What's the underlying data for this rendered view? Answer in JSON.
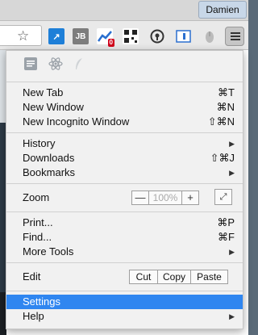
{
  "titlebar": {
    "user": "Damien"
  },
  "toolbar": {
    "star_icon": "star-icon",
    "extensions": [
      {
        "name": "arrow-icon",
        "glyph": "↗",
        "bg": "#1e7fd8",
        "color": "#ffffff"
      },
      {
        "name": "jb-icon",
        "glyph": "JB",
        "bg": "#7d7d7d",
        "color": "#ffffff"
      },
      {
        "name": "chart-icon",
        "glyph": "📈",
        "bg": "#2a6fcf",
        "color": "#ffffff",
        "badge": "0"
      },
      {
        "name": "qr-icon",
        "glyph": "▦",
        "bg": "#ffffff",
        "color": "#222222"
      },
      {
        "name": "pin-icon",
        "glyph": "◉",
        "bg": "#e9e9e9",
        "color": "#333333"
      },
      {
        "name": "page-icon",
        "glyph": "◧",
        "bg": "#e9e9e9",
        "color": "#2a6fcf"
      },
      {
        "name": "mouse-icon",
        "glyph": "●",
        "bg": "#e9e9e9",
        "color": "#9a9a9a"
      }
    ],
    "menu_icon": "hamburger-menu-icon"
  },
  "menu": {
    "icons": [
      "notes-icon",
      "react-atom-icon",
      "feather-icon"
    ],
    "new_tab": "New Tab",
    "new_tab_sc": "⌘T",
    "new_window": "New Window",
    "new_window_sc": "⌘N",
    "new_incognito": "New Incognito Window",
    "new_incognito_sc": "⇧⌘N",
    "history": "History",
    "downloads": "Downloads",
    "downloads_sc": "⇧⌘J",
    "bookmarks": "Bookmarks",
    "zoom": "Zoom",
    "zoom_minus": "—",
    "zoom_level": "100%",
    "zoom_plus": "+",
    "print": "Print...",
    "print_sc": "⌘P",
    "find": "Find...",
    "find_sc": "⌘F",
    "more_tools": "More Tools",
    "edit": "Edit",
    "cut": "Cut",
    "copy": "Copy",
    "paste": "Paste",
    "settings": "Settings",
    "help": "Help",
    "arrow": "▶",
    "selected_color": "#2f86f0"
  }
}
